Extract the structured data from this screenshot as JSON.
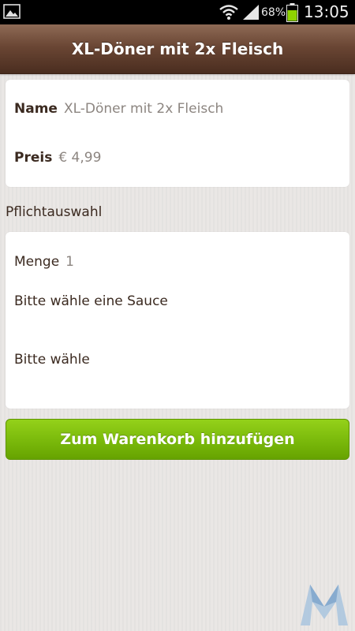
{
  "status_bar": {
    "battery_percent": "68%",
    "battery_level": 0.68,
    "time": "13:05"
  },
  "header": {
    "title": "XL-Döner mit 2x Fleisch"
  },
  "product": {
    "name_label": "Name",
    "name_value": "XL-Döner mit 2x Fleisch",
    "price_label": "Preis",
    "price_value": "€ 4,99"
  },
  "required_section": {
    "title": "Pflichtauswahl",
    "quantity_label": "Menge",
    "quantity_value": "1",
    "sauce_prompt": "Bitte wähle eine Sauce",
    "choice_prompt": "Bitte wähle"
  },
  "actions": {
    "add_to_cart_label": "Zum Warenkorb hinzufügen"
  },
  "colors": {
    "header_brown": "#6a4634",
    "button_green": "#7cbb0c",
    "battery_green": "#8fd400",
    "text_brown": "#3b2a20",
    "value_gray": "#8c8580"
  },
  "icons": {
    "gallery": "gallery-icon",
    "wifi": "wifi-icon",
    "signal": "signal-icon",
    "battery": "battery-icon",
    "watermark": "logo-icon"
  }
}
